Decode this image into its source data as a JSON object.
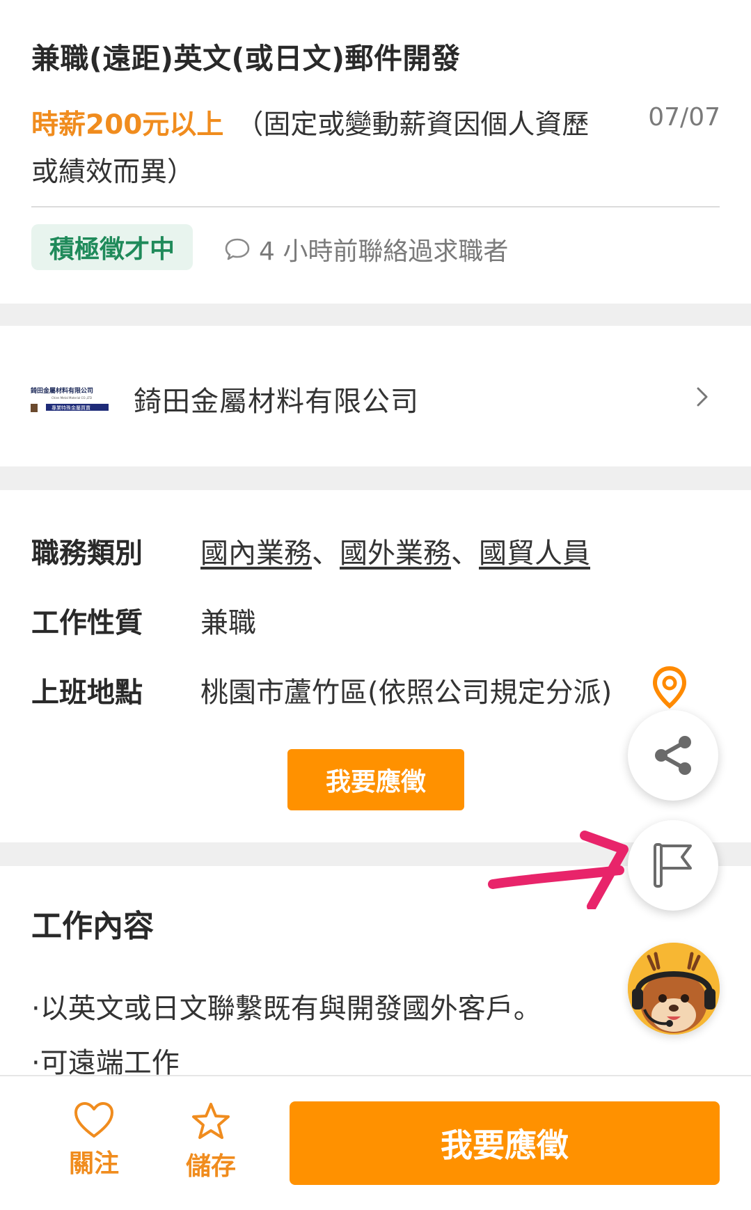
{
  "job": {
    "title": "兼職(遠距)英文(或日文)郵件開發",
    "salary": "時薪200元以上",
    "salary_note": "（固定或變動薪資因個人資歷或績效而異）",
    "date": "07/07",
    "badge": "積極徵才中",
    "contact_status": "4 小時前聯絡過求職者"
  },
  "company": {
    "logo_text": "錡田金屬材料有限公司",
    "logo_subtext": "Chien Metal Material CO.,LTD",
    "logo_banner": "專業特殊金屬買賣",
    "name": "錡田金屬材料有限公司"
  },
  "details": {
    "category_label": "職務類別",
    "categories": [
      "國內業務",
      "國外業務",
      "國貿人員"
    ],
    "separator": "、",
    "type_label": "工作性質",
    "type_value": "兼職",
    "location_label": "上班地點",
    "location_value": "桃園市蘆竹區(依照公司規定分派)"
  },
  "apply_label": "我要應徵",
  "description": {
    "heading": "工作內容",
    "lines": [
      "·以英文或日文聯繫既有與開發國外客戶。",
      "·可遠端工作"
    ]
  },
  "bottom_bar": {
    "follow_label": "關注",
    "save_label": "儲存",
    "apply_label": "我要應徵"
  },
  "colors": {
    "accent": "#ff9100",
    "badge_green": "#1f8a5a",
    "annotation_arrow": "#e8246a"
  }
}
